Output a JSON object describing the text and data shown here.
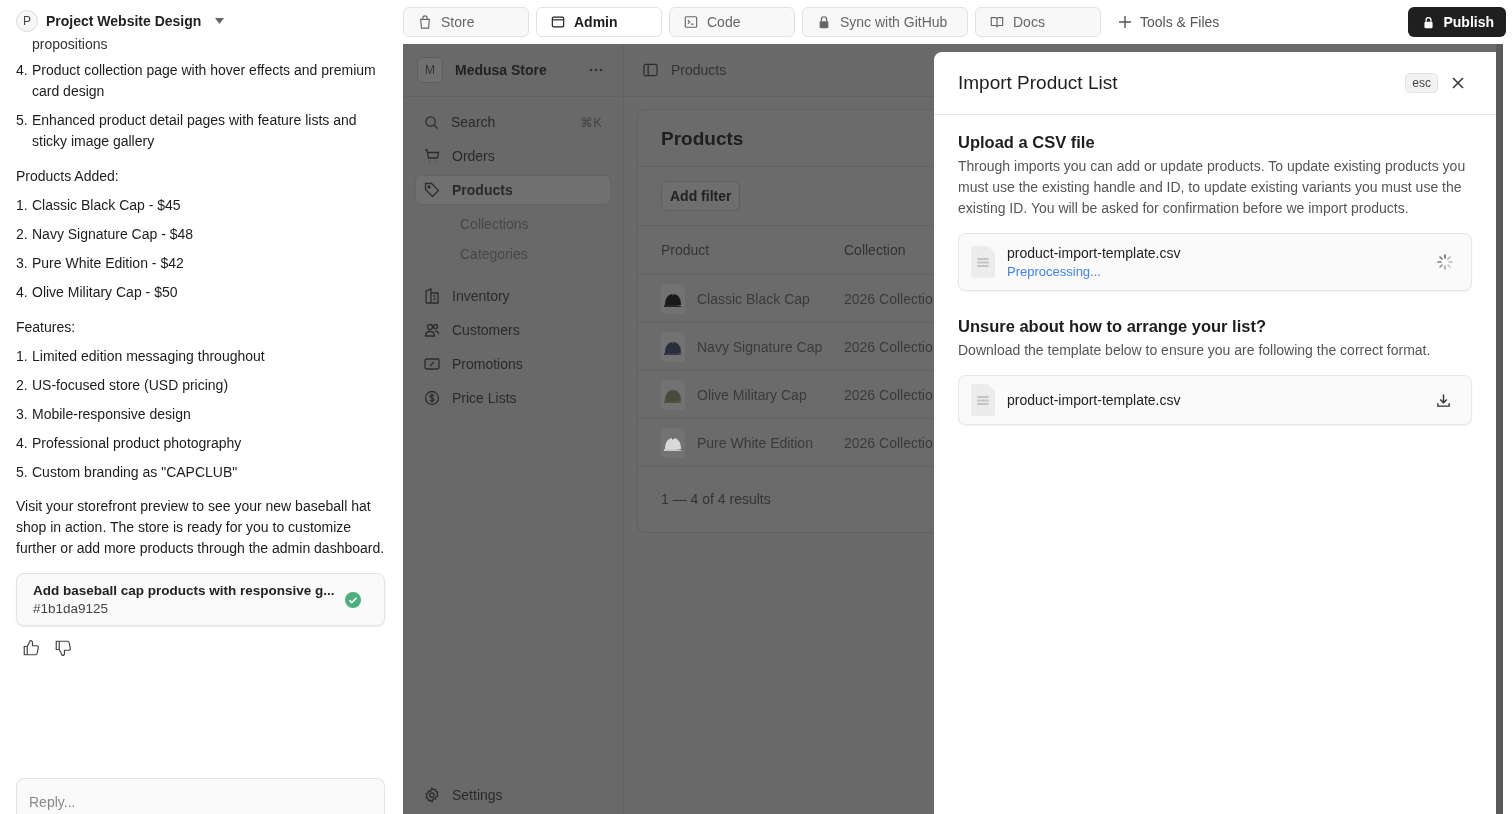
{
  "project": {
    "avatar": "P",
    "title": "Project Website Design"
  },
  "chat": {
    "blocks": [
      {
        "kind": "continuation",
        "text": "propositions"
      },
      {
        "kind": "item",
        "number": "4.",
        "text": "Product collection page with hover effects and premium card design"
      },
      {
        "kind": "item",
        "number": "5.",
        "text": "Enhanced product detail pages with feature lists and sticky image gallery"
      },
      {
        "kind": "heading",
        "text": "Products Added:"
      },
      {
        "kind": "item",
        "number": "1.",
        "text": "Classic Black Cap - $45"
      },
      {
        "kind": "item",
        "number": "2.",
        "text": "Navy Signature Cap - $48"
      },
      {
        "kind": "item",
        "number": "3.",
        "text": "Pure White Edition - $42"
      },
      {
        "kind": "item",
        "number": "4.",
        "text": "Olive Military Cap - $50"
      },
      {
        "kind": "heading",
        "text": "Features:"
      },
      {
        "kind": "item",
        "number": "1.",
        "text": "Limited edition messaging throughout"
      },
      {
        "kind": "item",
        "number": "2.",
        "text": "US-focused store (USD pricing)"
      },
      {
        "kind": "item",
        "number": "3.",
        "text": "Mobile-responsive design"
      },
      {
        "kind": "item",
        "number": "4.",
        "text": "Professional product photography"
      },
      {
        "kind": "item",
        "number": "5.",
        "text": "Custom branding as \"CAPCLUB\""
      },
      {
        "kind": "paragraph",
        "text": "Visit your storefront preview to see your new baseball hat shop in action. The store is ready for you to customize further or add more products through the admin dashboard."
      }
    ],
    "commit": {
      "title": "Add baseball cap products with responsive g...",
      "hash": "#1b1da9125",
      "done": true
    },
    "reply": {
      "placeholder": "Reply..."
    }
  },
  "tabs": [
    {
      "label": "Store",
      "selected": false
    },
    {
      "label": "Admin",
      "selected": true
    },
    {
      "label": "Code",
      "selected": false
    },
    {
      "label": "Sync with GitHub",
      "selected": false
    },
    {
      "label": "Docs",
      "selected": false
    }
  ],
  "tools_button": "Tools & Files",
  "publish_button": "Publish",
  "admin": {
    "store": {
      "avatar": "M",
      "name": "Medusa Store"
    },
    "search": {
      "label": "Search",
      "shortcut": "⌘K"
    },
    "nav": [
      {
        "label": "Orders",
        "selected": false
      },
      {
        "label": "Products",
        "selected": true,
        "children": [
          {
            "label": "Collections",
            "selected": false
          },
          {
            "label": "Categories",
            "selected": false
          }
        ]
      },
      {
        "label": "Inventory",
        "selected": false
      },
      {
        "label": "Customers",
        "selected": false
      },
      {
        "label": "Promotions",
        "selected": false
      },
      {
        "label": "Price Lists",
        "selected": false
      }
    ],
    "settings": "Settings",
    "breadcrumb": "Products",
    "page_title": "Products",
    "filter_button": "Add filter",
    "columns": [
      "Product",
      "Collection"
    ],
    "rows": [
      {
        "product": "Classic Black Cap",
        "collection": "2026 Collectio"
      },
      {
        "product": "Navy Signature Cap",
        "collection": "2026 Collectio"
      },
      {
        "product": "Olive Military Cap",
        "collection": "2026 Collectio"
      },
      {
        "product": "Pure White Edition",
        "collection": "2026 Collectio"
      }
    ],
    "pagination": "1 — 4 of 4 results"
  },
  "drawer": {
    "title": "Import Product List",
    "esc": "esc",
    "upload": {
      "heading": "Upload a CSV file",
      "description": "Through imports you can add or update products. To update existing products you must use the existing handle and ID, to update existing variants you must use the existing ID. You will be asked for confirmation before we import products.",
      "file": {
        "name": "product-import-template.csv",
        "status": "Preprocessing...",
        "loading": true
      }
    },
    "template": {
      "heading": "Unsure about how to arrange your list?",
      "description": "Download the template below to ensure you are following the correct format.",
      "file": {
        "name": "product-import-template.csv"
      }
    }
  }
}
